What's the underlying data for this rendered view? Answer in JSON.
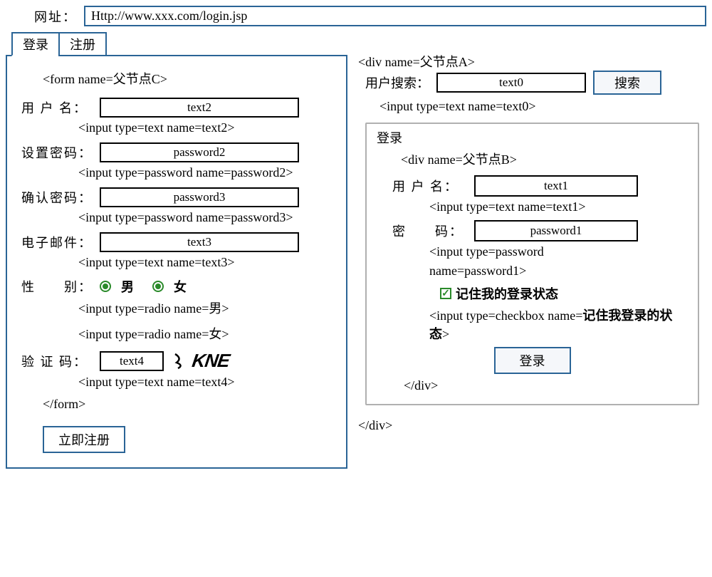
{
  "address": {
    "label": "网址：",
    "value": "Http://www.xxx.com/login.jsp"
  },
  "tabs": {
    "login": "登录",
    "register": "注册"
  },
  "left": {
    "form_open": "<form name=父节点C>",
    "username_label": "用 户 名：",
    "username_value": "text2",
    "username_hint": "<input type=text name=text2>",
    "setpwd_label": "设置密码：",
    "setpwd_value": "password2",
    "setpwd_hint": "<input type=password name=password2>",
    "cfmpwd_label": "确认密码：",
    "cfmpwd_value": "password3",
    "cfmpwd_hint": "<input type=password name=password3>",
    "email_label": "电子邮件：",
    "email_value": "text3",
    "email_hint": "<input type=text name=text3>",
    "gender_label": "性　　别：",
    "male": "男",
    "female": "女",
    "radio_male_hint": "<input type=radio name=男>",
    "radio_female_hint": "<input type=radio name=女>",
    "captcha_label": "验 证 码：",
    "captcha_value": "text4",
    "captcha_img": "KNE",
    "captcha_hint": "<input type=text name=text4>",
    "form_close": "</form>",
    "submit": "立即注册"
  },
  "right": {
    "div_a_open": "<div name=父节点A>",
    "search_label": "用户搜索：",
    "search_value": "text0",
    "search_btn": "搜索",
    "search_hint": "<input type=text name=text0>",
    "login_legend": "登录",
    "div_b_open": "<div name=父节点B>",
    "user_label": "用 户 名：",
    "user_value": "text1",
    "user_hint": "<input type=text name=text1>",
    "pwd_label": "密　　码：",
    "pwd_value": "password1",
    "pwd_hint1": "<input type=password",
    "pwd_hint2": "name=password1>",
    "remember": "记住我的登录状态",
    "cb_hint1": "<input type=checkbox name=",
    "cb_hint_bold": "记住我登录的状态",
    "cb_hint2": ">",
    "login_btn": "登录",
    "div_b_close": "</div>",
    "div_a_close": "</div>"
  }
}
